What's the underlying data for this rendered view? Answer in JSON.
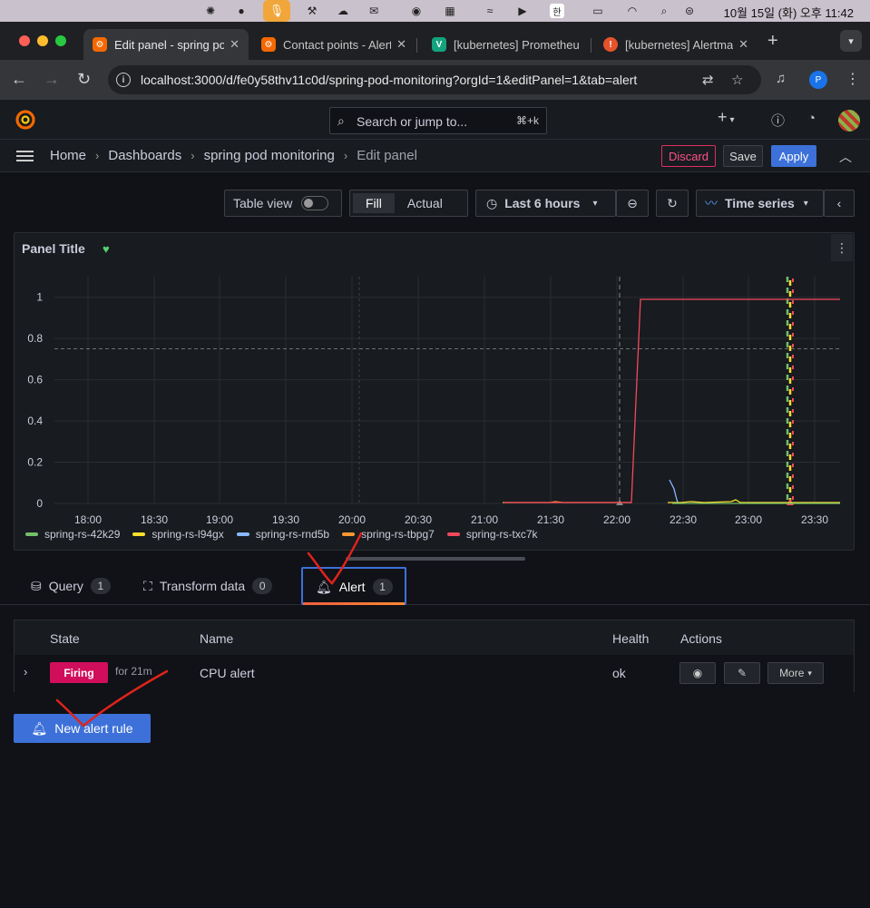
{
  "menubar": {
    "clock": "10월 15일 (화) 오후 11:42",
    "input_source": "한"
  },
  "browser": {
    "tabs": [
      {
        "label": "Edit panel - spring pod monitoring",
        "icon": "grafana-icon",
        "active": true
      },
      {
        "label": "Contact points - Alerting",
        "icon": "grafana-icon",
        "active": false
      },
      {
        "label": "[kubernetes] Prometheus",
        "icon": "v-icon",
        "active": false
      },
      {
        "label": "[kubernetes] Alertmanager",
        "icon": "alertmanager-icon",
        "active": false
      }
    ],
    "url": "localhost:3000/d/fe0y58thv11c0d/spring-pod-monitoring?orgId=1&editPanel=1&tab=alert",
    "profile_initial": "P"
  },
  "header": {
    "search_placeholder": "Search or jump to...",
    "search_shortcut": "⌘+k",
    "add_label": "+"
  },
  "breadcrumb": {
    "home": "Home",
    "dashboards": "Dashboards",
    "dashboard": "spring pod monitoring",
    "current": "Edit panel"
  },
  "actions": {
    "discard": "Discard",
    "save": "Save",
    "apply": "Apply"
  },
  "panel_toolbar": {
    "table_view": "Table view",
    "fill": "Fill",
    "actual": "Actual",
    "time_range": "Last 6 hours",
    "visualization": "Time series"
  },
  "panel": {
    "title": "Panel Title"
  },
  "chart_data": {
    "type": "line",
    "x_ticks": [
      "18:00",
      "18:30",
      "19:00",
      "19:30",
      "20:00",
      "20:30",
      "21:00",
      "21:30",
      "22:00",
      "22:30",
      "23:00",
      "23:30"
    ],
    "y_ticks": [
      "0",
      "0.2",
      "0.4",
      "0.6",
      "0.8",
      "1"
    ],
    "ylim": [
      0,
      1.1
    ],
    "threshold": 0.75,
    "series": [
      {
        "name": "spring-rs-42k29",
        "color": "#73bf69"
      },
      {
        "name": "spring-rs-l94gx",
        "color": "#fade2a"
      },
      {
        "name": "spring-rs-rnd5b",
        "color": "#8ab8ff"
      },
      {
        "name": "spring-rs-tbpg7",
        "color": "#ff9830"
      },
      {
        "name": "spring-rs-txc7k",
        "color": "#f2495c"
      }
    ]
  },
  "editor_tabs": [
    {
      "label": "Query",
      "count": "1"
    },
    {
      "label": "Transform data",
      "count": "0"
    },
    {
      "label": "Alert",
      "count": "1"
    }
  ],
  "alerts": {
    "columns": {
      "state": "State",
      "name": "Name",
      "health": "Health",
      "actions": "Actions"
    },
    "rows": [
      {
        "state": "Firing",
        "duration": "for 21m",
        "name": "CPU alert",
        "health": "ok",
        "more": "More"
      }
    ],
    "new_rule": "New alert rule"
  }
}
